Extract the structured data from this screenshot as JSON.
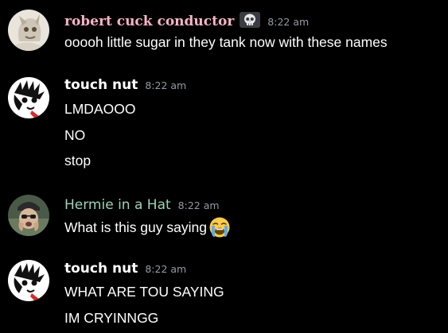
{
  "colors": {
    "background": "#000000",
    "robert_name": "#f8b4c6",
    "touch_nut_name": "#ffffff",
    "hermie_name": "#9fd3b5",
    "timestamp": "#949ba4",
    "message_text": "#ffffff"
  },
  "messages": [
    {
      "author": "robert cuck conductor",
      "badge_icon": "skull-icon",
      "time": "8:22 am",
      "lines": [
        "ooooh little sugar in they tank now with these names"
      ]
    },
    {
      "author": "touch nut",
      "time": "8:22 am",
      "lines": [
        "LMDAOOO",
        "NO",
        "stop"
      ]
    },
    {
      "author": "Hermie in a Hat",
      "time": "8:22 am",
      "lines": [
        "What is this guy saying"
      ],
      "trailing_emoji": "loudly-crying-face-icon"
    },
    {
      "author": "touch nut",
      "time": "8:22 am",
      "lines": [
        "WHAT ARE TOU SAYING",
        "IM CRYINNGG"
      ]
    }
  ]
}
